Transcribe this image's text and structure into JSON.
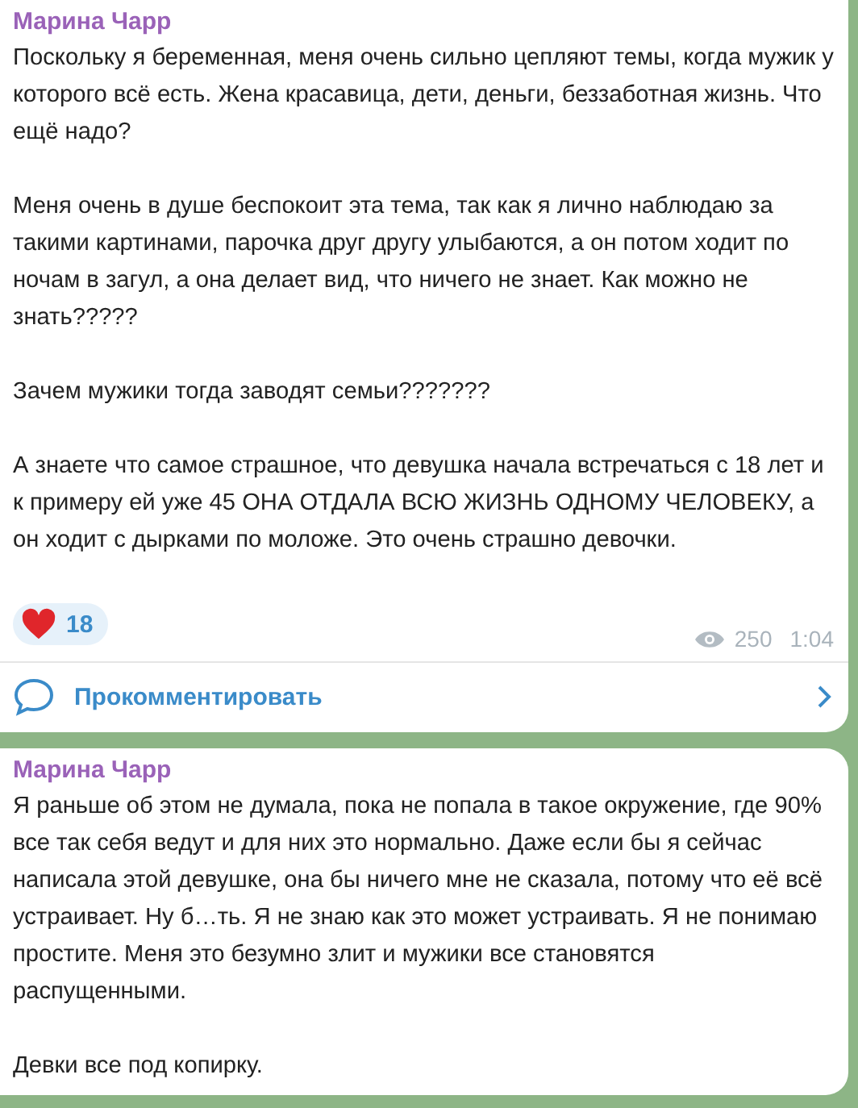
{
  "posts": [
    {
      "author": "Марина Чарр",
      "paragraphs": [
        "Поскольку я беременная, меня очень сильно цепляют темы, когда мужик у которого всё есть. Жена красавица, дети, деньги, беззаботная жизнь. Что ещё надо?",
        "Меня очень в душе беспокоит эта тема, так как я лично наблюдаю за такими картинами, парочка друг другу улыбаются, а он потом ходит по ночам в загул, а она делает вид, что ничего не знает. Как можно не знать?????",
        "Зачем мужики тогда заводят семьи???????",
        "А знаете что самое страшное, что девушка начала встречаться с 18 лет и к примеру ей уже 45 ОНА ОТДАЛА ВСЮ ЖИЗНЬ ОДНОМУ ЧЕЛОВЕКУ, а он ходит с дырками по моложе. Это очень страшно девочки."
      ],
      "reactions": [
        {
          "kind": "heart",
          "count": "18"
        }
      ],
      "views": "250",
      "time": "1:04",
      "comment_label": "Прокомментировать"
    },
    {
      "author": "Марина Чарр",
      "paragraphs": [
        "Я раньше об этом не думала, пока не попала в такое окружение, где 90% все так себя ведут и для них это нормально. Даже если бы я сейчас написала этой девушке, она бы ничего мне не сказала, потому что её всё устраивает. Ну б…ть. Я не знаю как это может устраивать. Я не понимаю простите. Меня это безумно злит и мужики все становятся распущенными.",
        "Девки все под копирку."
      ]
    }
  ]
}
